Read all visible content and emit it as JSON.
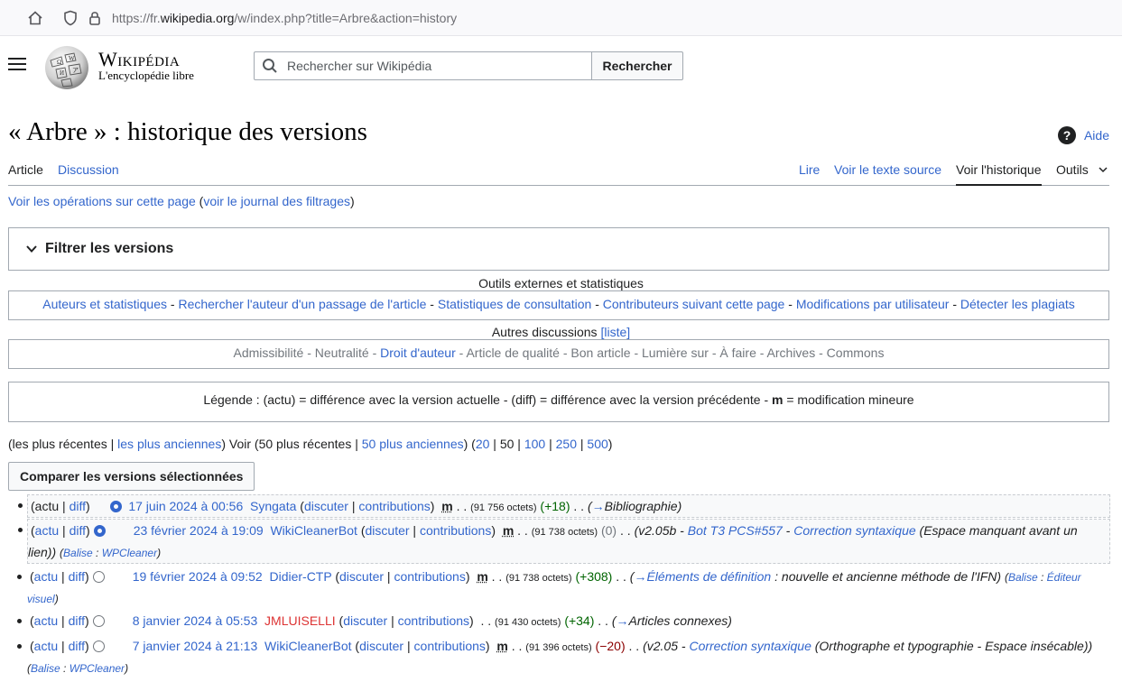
{
  "browser": {
    "url_prefix": "https://fr.",
    "url_domain": "wikipedia.org",
    "url_path": "/w/index.php?title=Arbre&action=history"
  },
  "header": {
    "wordmark": "Wikipédia",
    "tagline": "L'encyclopédie libre",
    "search_placeholder": "Rechercher sur Wikipédia",
    "search_button": "Rechercher"
  },
  "page": {
    "title": "« Arbre » : historique des versions",
    "help": "Aide"
  },
  "tabs": {
    "article": "Article",
    "discussion": "Discussion",
    "read": "Lire",
    "view_source": "Voir le texte source",
    "history": "Voir l'historique",
    "tools": "Outils"
  },
  "ops": {
    "link": "Voir les opérations sur cette page",
    "filter_log": "voir le journal des filtrages"
  },
  "filter": {
    "title": "Filtrer les versions"
  },
  "external": {
    "legend": "Outils externes et statistiques",
    "links": [
      "Auteurs et statistiques",
      "Rechercher l'auteur d'un passage de l'article",
      "Statistiques de consultation",
      "Contributeurs suivant cette page",
      "Modifications par utilisateur",
      "Détecter les plagiats"
    ]
  },
  "discussions": {
    "legend": "Autres discussions",
    "list_link": "[liste]",
    "items": [
      {
        "label": "Admissibilité",
        "link": false
      },
      {
        "label": "Neutralité",
        "link": false
      },
      {
        "label": "Droit d'auteur",
        "link": true
      },
      {
        "label": "Article de qualité",
        "link": false
      },
      {
        "label": "Bon article",
        "link": false
      },
      {
        "label": "Lumière sur",
        "link": false
      },
      {
        "label": "À faire",
        "link": false
      },
      {
        "label": "Archives",
        "link": false
      },
      {
        "label": "Commons",
        "link": false
      }
    ]
  },
  "legend": {
    "text1": "Légende : (actu) = différence avec la version actuelle - (diff) = différence avec la version précédente - ",
    "m": "m",
    "text2": " = modification mineure"
  },
  "nav": {
    "recent": "les plus récentes",
    "oldest": "les plus anciennes",
    "view": "Voir",
    "recent50": "50 plus récentes",
    "older50": "50 plus anciennes",
    "limits": [
      "20",
      "50",
      "100",
      "250",
      "500"
    ],
    "current_limit": "50"
  },
  "compare_button": "Comparer les versions sélectionnées",
  "common": {
    "actu": "actu",
    "diff": "diff",
    "talk": "discuter",
    "contribs": "contributions",
    "m": "m",
    "balise": "Balise",
    "dots": ". ."
  },
  "history": [
    {
      "date": "17 juin 2024 à 00:56",
      "user": "Syngata",
      "size": "(91 756 octets)",
      "delta": "(+18)",
      "summary_arrow": "→",
      "summary": "Bibliographie"
    },
    {
      "date": "23 février 2024 à 19:09",
      "user": "WikiCleanerBot",
      "size": "(91 738 octets)",
      "delta": "(0)",
      "s1": "v2.05b",
      "s2": "Bot T3 PCS#557",
      "s3": "Correction syntaxique",
      "s4": "(Espace manquant avant un",
      "s5": "lien))",
      "tag": "WPCleaner"
    },
    {
      "date": "19 février 2024 à 09:52",
      "user": "Didier-CTP",
      "size": "(91 738 octets)",
      "delta": "(+308)",
      "summary_arrow": "→",
      "section": "Éléments de définition",
      "summary": " : nouvelle et ancienne méthode de l'IFN)",
      "tag1": "Éditeur",
      "tag2": "visuel"
    },
    {
      "date": "8 janvier 2024 à 05:53",
      "user": "JMLUISELLI",
      "size": "(91 430 octets)",
      "delta": "(+34)",
      "summary_arrow": "→",
      "summary": "Articles connexes"
    },
    {
      "date": "7 janvier 2024 à 21:13",
      "user": "WikiCleanerBot",
      "size": "(91 396 octets)",
      "delta": "(−20)",
      "s1": "v2.05",
      "s2": "Correction syntaxique",
      "s3": "(Orthographe et typographie - Espace insécable))",
      "tag": "WPCleaner"
    }
  ]
}
